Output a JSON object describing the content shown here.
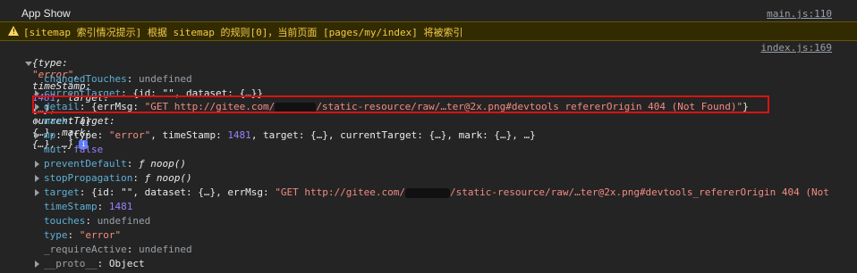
{
  "header": {
    "title": "App Show",
    "source": "main.js:110"
  },
  "warning": {
    "message": "[sitemap 索引情况提示] 根据 sitemap 的规则[0]，当前页面 [pages/my/index] 将被索引"
  },
  "log": {
    "source": "index.js:169",
    "summary": {
      "open": "{type: ",
      "type_val": "\"error\"",
      "ts_key": ", timeStamp: ",
      "ts_val": "1481",
      "rest": ", target: {…}, currentTarget: {…}, mark: {…}, …}"
    },
    "rows": [
      {
        "key": "changedTouches",
        "sep": ": ",
        "value": "undefined"
      },
      {
        "key": "currentTarget",
        "sep": ": ",
        "value": "{id: \"\", dataset: {…}}"
      },
      {
        "key": "detail",
        "sep": ": ",
        "pre": "{errMsg: ",
        "value": "\"GET http://gitee.com/",
        "value2": "/static-resource/raw/…ter@2x.png#devtools_refererOrigin 404 (Not Found)\"",
        "post": "}"
      },
      {
        "key": "mark",
        "sep": ": ",
        "value": "{}"
      },
      {
        "key": "mp",
        "sep": ": ",
        "pre": "{type: ",
        "type_val": "\"error\"",
        "ts_key": ", timeStamp: ",
        "ts_val": "1481",
        "rest": ", target: {…}, currentTarget: {…}, mark: {…}, …}"
      },
      {
        "key": "mut",
        "sep": ": ",
        "value": "false"
      },
      {
        "key": "preventDefault",
        "sep": ": ",
        "fsym": "ƒ",
        "value": " noop()"
      },
      {
        "key": "stopPropagation",
        "sep": ": ",
        "fsym": "ƒ",
        "value": " noop()"
      },
      {
        "key": "target",
        "sep": ": ",
        "pre": "{id: \"\", dataset: {…}, errMsg: ",
        "value": "\"GET http://gitee.com/",
        "value2": "/static-resource/raw/…ter@2x.png#devtools_refererOrigin 404 (Not"
      },
      {
        "key": "timeStamp",
        "sep": ": ",
        "value": "1481"
      },
      {
        "key": "touches",
        "sep": ": ",
        "value": "undefined"
      },
      {
        "key": "type",
        "sep": ": ",
        "value": "\"error\""
      },
      {
        "key": "_requireActive",
        "sep": ": ",
        "value": "undefined"
      },
      {
        "key": "__proto__",
        "sep": ": ",
        "value": "Object"
      }
    ]
  },
  "colors": {
    "background": "#242424",
    "warning_bg": "#332b00",
    "highlight_border": "#dd1111"
  }
}
